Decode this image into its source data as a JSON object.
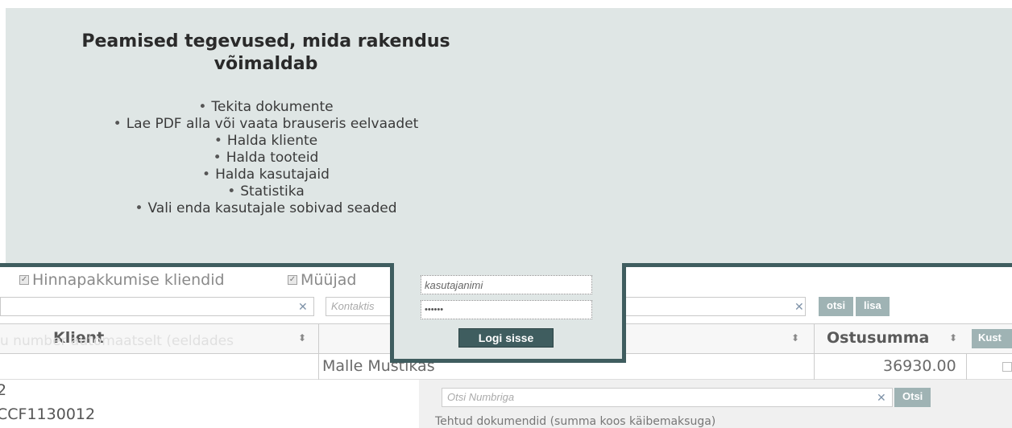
{
  "info": {
    "title": "Peamised tegevused, mida rakendus võimaldab",
    "features": [
      "Tekita dokumente",
      "Lae PDF alla või vaata brauseris eelvaadet",
      "Halda kliente",
      "Halda tooteid",
      "Halda kasutajaid",
      "Statistika",
      "Vali enda kasutajale sobivad seaded"
    ]
  },
  "login": {
    "username_placeholder": "kasutajanimi",
    "password_value": "••••••",
    "submit_label": "Logi sisse"
  },
  "background": {
    "filters": [
      {
        "label": "Hinnapakkumise kliendid",
        "checked": true
      },
      {
        "label": "Müüjad",
        "checked": true
      }
    ],
    "contact_search_placeholder": "Kontaktis",
    "search_button": "otsi",
    "add_button": "lisa",
    "columns": {
      "client": "Klient",
      "purchase_sum": "Ostusumma",
      "customer_truncated": "Kust"
    },
    "faint_hint": "u number automaatselt (eeldades",
    "row": {
      "contact": "Malle Mustikas",
      "amount": "36930.00"
    },
    "lower": {
      "left_line1": "2",
      "left_line2": "CCF1130012",
      "number_search_placeholder": "Otsi Numbriga",
      "number_search_button": "Otsi",
      "docs_caption": "Tehtud dokumendid (summa koos käibemaksuga)"
    }
  },
  "colors": {
    "panel_bg": "#dfe6e5",
    "frame": "#3f5d5f",
    "button_bg": "#3f5d5f",
    "bg_button": "#9fb3b4"
  }
}
